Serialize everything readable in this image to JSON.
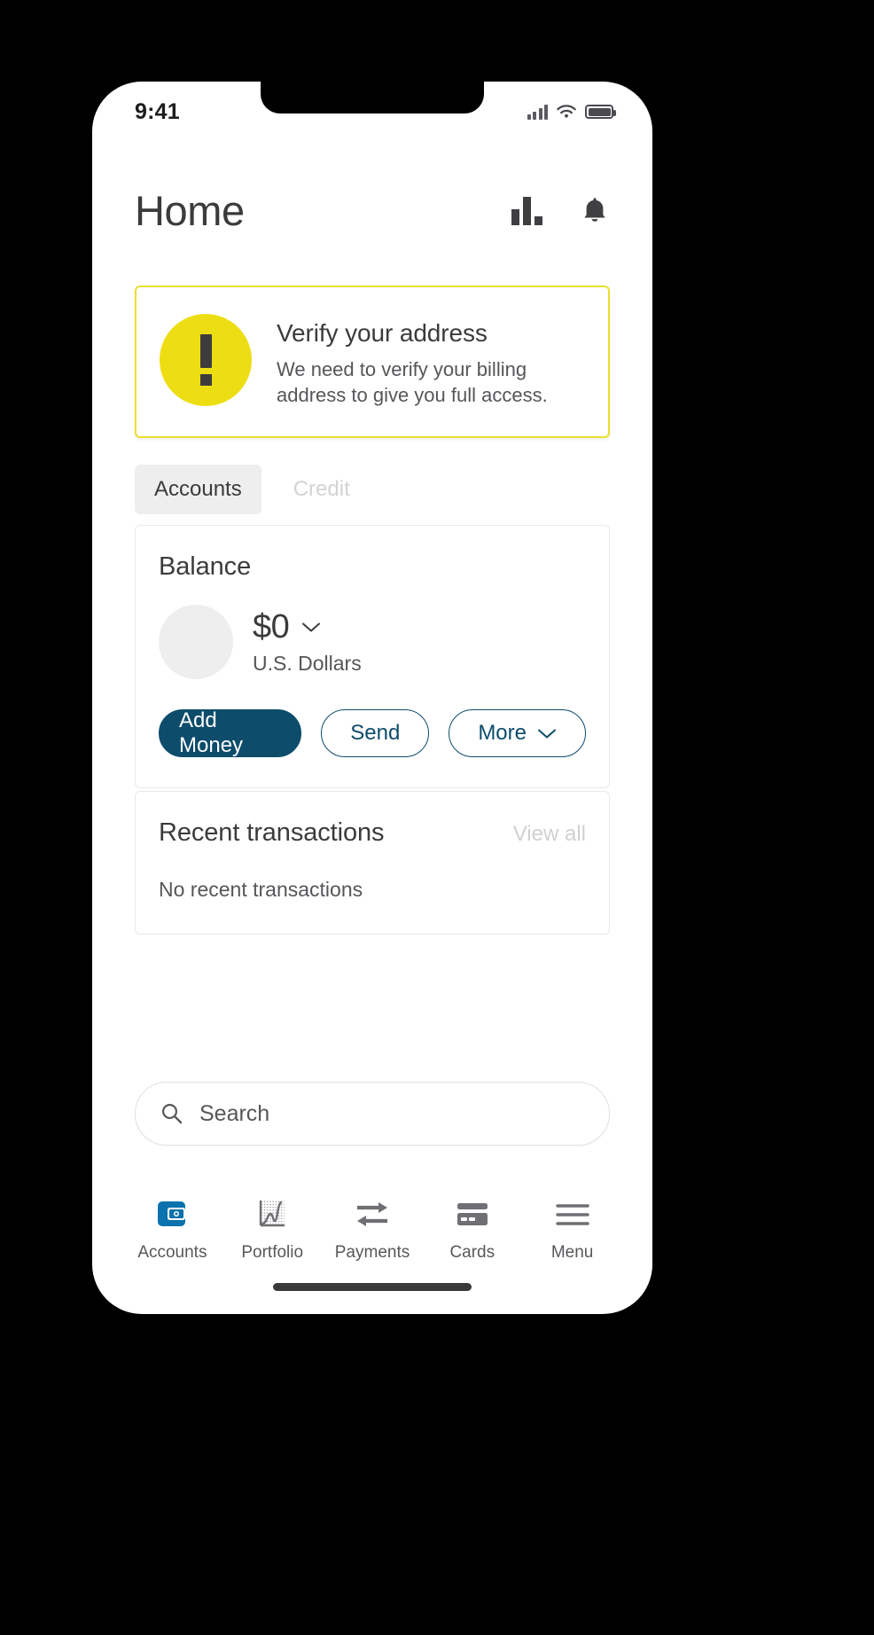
{
  "status_bar": {
    "time": "9:41",
    "signal_icon": "cellular-signal-icon",
    "wifi_icon": "wifi-icon",
    "battery_icon": "battery-icon"
  },
  "header": {
    "title": "Home",
    "chart_icon": "bar-chart-icon",
    "bell_icon": "bell-icon"
  },
  "alert": {
    "icon": "exclamation-icon",
    "title": "Verify your address",
    "body": "We need to verify your billing address to give you full access.",
    "border_color": "#ecdf2e",
    "badge_color": "#edde14"
  },
  "tabs": [
    {
      "label": "Accounts",
      "active": true
    },
    {
      "label": "Credit",
      "active": false
    }
  ],
  "balance_card": {
    "title": "Balance",
    "amount": "$0",
    "currency": "U.S. Dollars",
    "chevron_icon": "chevron-down-icon",
    "buttons": [
      {
        "label": "Add Money",
        "style": "primary"
      },
      {
        "label": "Send",
        "style": "outline"
      },
      {
        "label": "More",
        "style": "outline",
        "chevron_icon": "chevron-down-icon"
      }
    ],
    "accent_color": "#0d4c6b"
  },
  "transactions_card": {
    "title": "Recent transactions",
    "view_all_label": "View all",
    "empty_label": "No recent transactions"
  },
  "search": {
    "placeholder": "Search",
    "icon": "search-icon"
  },
  "bottom_nav": [
    {
      "label": "Accounts",
      "icon": "wallet-icon",
      "active": true
    },
    {
      "label": "Portfolio",
      "icon": "line-chart-icon",
      "active": false
    },
    {
      "label": "Payments",
      "icon": "transfer-arrows-icon",
      "active": false
    },
    {
      "label": "Cards",
      "icon": "credit-card-icon",
      "active": false
    },
    {
      "label": "Menu",
      "icon": "hamburger-menu-icon",
      "active": false
    }
  ],
  "colors": {
    "brand_blue": "#0d4c6b",
    "nav_active_blue": "#0b72ad",
    "alert_yellow": "#edde14",
    "text_dark": "#3b3b3d",
    "text_muted": "#56565a"
  }
}
